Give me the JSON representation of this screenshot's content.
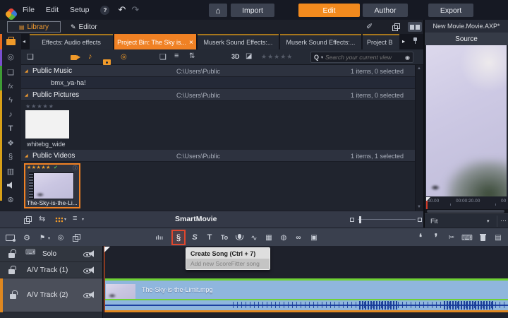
{
  "icons": {
    "help": "?",
    "undo": "↶",
    "redo": "↷",
    "home": "⌂",
    "library_glyph": "▤",
    "editor_glyph": "✎",
    "tab_prev": "◂",
    "tab_next": "▸",
    "tab_close": "×",
    "brush": "✐",
    "collapse": "◢",
    "stars_empty": "★★★★★",
    "stars_rated": "★★★★★",
    "check": "✔",
    "info": "ⓘ",
    "three_d": "3D",
    "tag": "◪",
    "search_q": "Q",
    "search_dd": "▾",
    "search_clear": "◉",
    "folder": "❏",
    "folder_new": "❏",
    "music_note": "♪",
    "list": "≡",
    "sort": "⇅",
    "dd": "▾",
    "sync": "⇆",
    "scroll_up": "▲",
    "scroll_down": "▼",
    "reel": "◎",
    "fx": "fx",
    "lightning": "ϟ",
    "titles": "T",
    "montage": "❖",
    "clef": "§",
    "piano": "▥",
    "disc": "⊛",
    "gear": "⚙",
    "flag": "⚑",
    "target": "◎",
    "mix": "ılıı",
    "create_song": "§",
    "song": "S",
    "title_tool": "T",
    "subtitle_tool": "To",
    "wave": "∿",
    "multicam": "▦",
    "layers": "◍",
    "link": "∞",
    "photo": "▣",
    "trim_in": "❛",
    "trim_out": "❜",
    "split": "✂",
    "keyboard": "⌨",
    "snapshot": "▤",
    "more": "⋯",
    "fit_dd": "▾"
  },
  "menubar": {
    "items": [
      "File",
      "Edit",
      "Setup"
    ]
  },
  "nav": {
    "import": "Import",
    "edit": "Edit",
    "author": "Author",
    "export": "Export"
  },
  "mode_tabs": {
    "library": "Library",
    "editor": "Editor"
  },
  "project_title": "New Movie.Movie.AXP*",
  "tabs": [
    {
      "label": "Effects: Audio effects"
    },
    {
      "label": "Project Bin: The Sky is..."
    },
    {
      "label": "Muserk Sound Effects:..."
    },
    {
      "label": "Muserk Sound Effects:..."
    },
    {
      "label": "Project B"
    }
  ],
  "search": {
    "placeholder": "Search your current view"
  },
  "library": {
    "groups": [
      {
        "name": "Public Music",
        "path": "C:\\Users\\Public",
        "status": "1 items, 0 selected"
      },
      {
        "name": "Public Pictures",
        "path": "C:\\Users\\Public",
        "status": "1 items, 0 selected"
      },
      {
        "name": "Public Videos",
        "path": "C:\\Users\\Public",
        "status": "1 items, 1 selected"
      }
    ],
    "music_item": "bmx_ya-ha!",
    "picture_label": "whitebg_wide",
    "video_label": "The-Sky-is-the-Li..."
  },
  "smartmovie": {
    "label": "SmartMovie"
  },
  "tooltip": {
    "title": "Create Song (Ctrl + 7)",
    "subtitle": "Add new ScoreFitter song"
  },
  "tracks": [
    {
      "name": "Solo"
    },
    {
      "name": "A/V Track (1)"
    },
    {
      "name": "A/V Track (2)"
    }
  ],
  "clip": {
    "label": "The-Sky-is-the-Limit.mpg"
  },
  "source": {
    "title": "Source",
    "fit": "Fit",
    "ruler": [
      "00.00",
      "00:00:20.00",
      "00"
    ]
  }
}
